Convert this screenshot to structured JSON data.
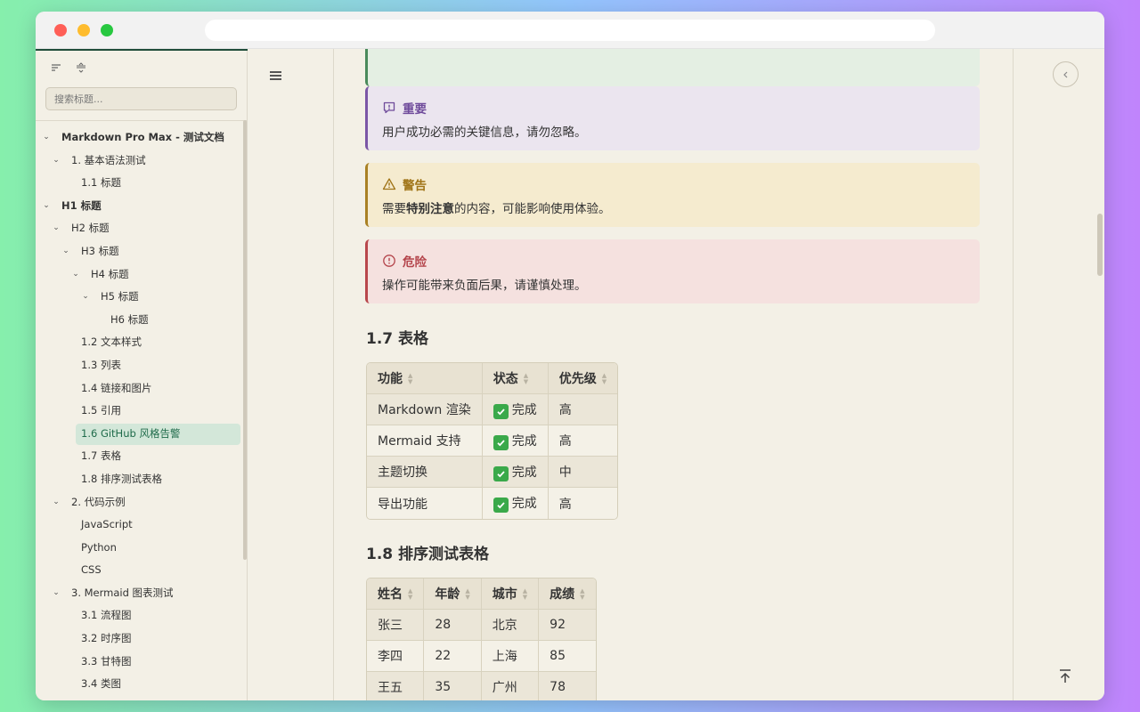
{
  "sidebar": {
    "search_placeholder": "搜索标题...",
    "toc": [
      {
        "label": "Markdown Pro Max - 测试文档",
        "level": 0,
        "chevron": true,
        "bold": true
      },
      {
        "label": "1. 基本语法测试",
        "level": 1,
        "chevron": true,
        "bold": false
      },
      {
        "label": "1.1 标题",
        "level": 2,
        "chevron": false,
        "bold": false
      },
      {
        "label": "H1 标题",
        "level": 0,
        "chevron": true,
        "bold": true
      },
      {
        "label": "H2 标题",
        "level": 1,
        "chevron": true,
        "bold": false
      },
      {
        "label": "H3 标题",
        "level": 2,
        "chevron": true,
        "bold": false
      },
      {
        "label": "H4 标题",
        "level": 3,
        "chevron": true,
        "bold": false
      },
      {
        "label": "H5 标题",
        "level": 4,
        "chevron": true,
        "bold": false
      },
      {
        "label": "H6 标题",
        "level": 5,
        "chevron": false,
        "bold": false
      },
      {
        "label": "1.2 文本样式",
        "level": 2,
        "chevron": false,
        "bold": false
      },
      {
        "label": "1.3 列表",
        "level": 2,
        "chevron": false,
        "bold": false
      },
      {
        "label": "1.4 链接和图片",
        "level": 2,
        "chevron": false,
        "bold": false
      },
      {
        "label": "1.5 引用",
        "level": 2,
        "chevron": false,
        "bold": false
      },
      {
        "label": "1.6 GitHub 风格告警",
        "level": 2,
        "chevron": false,
        "bold": false,
        "active": true
      },
      {
        "label": "1.7 表格",
        "level": 2,
        "chevron": false,
        "bold": false
      },
      {
        "label": "1.8 排序测试表格",
        "level": 2,
        "chevron": false,
        "bold": false
      },
      {
        "label": "2. 代码示例",
        "level": 1,
        "chevron": true,
        "bold": false
      },
      {
        "label": "JavaScript",
        "level": 2,
        "chevron": false,
        "bold": false
      },
      {
        "label": "Python",
        "level": 2,
        "chevron": false,
        "bold": false
      },
      {
        "label": "CSS",
        "level": 2,
        "chevron": false,
        "bold": false
      },
      {
        "label": "3. Mermaid 图表测试",
        "level": 1,
        "chevron": true,
        "bold": false
      },
      {
        "label": "3.1 流程图",
        "level": 2,
        "chevron": false,
        "bold": false
      },
      {
        "label": "3.2 时序图",
        "level": 2,
        "chevron": false,
        "bold": false
      },
      {
        "label": "3.3 甘特图",
        "level": 2,
        "chevron": false,
        "bold": false
      },
      {
        "label": "3.4 类图",
        "level": 2,
        "chevron": false,
        "bold": false
      }
    ]
  },
  "callouts": {
    "important": {
      "title": "重要",
      "body": "用户成功必需的关键信息，请勿忽略。"
    },
    "warning": {
      "title": "警告",
      "body_pre": "需要",
      "body_strong": "特别注意",
      "body_post": "的内容，可能影响使用体验。"
    },
    "danger": {
      "title": "危险",
      "body": "操作可能带来负面后果，请谨慎处理。"
    }
  },
  "section_17": {
    "heading": "1.7 表格",
    "headers": [
      "功能",
      "状态",
      "优先级"
    ],
    "rows": [
      [
        "Markdown 渲染",
        "完成",
        "高"
      ],
      [
        "Mermaid 支持",
        "完成",
        "高"
      ],
      [
        "主题切换",
        "完成",
        "中"
      ],
      [
        "导出功能",
        "完成",
        "高"
      ]
    ]
  },
  "section_18": {
    "heading": "1.8 排序测试表格",
    "headers": [
      "姓名",
      "年龄",
      "城市",
      "成绩"
    ],
    "rows": [
      [
        "张三",
        "28",
        "北京",
        "92"
      ],
      [
        "李四",
        "22",
        "上海",
        "85"
      ],
      [
        "王五",
        "35",
        "广州",
        "78"
      ],
      [
        "",
        "",
        "",
        ""
      ]
    ]
  },
  "colors": {
    "accent_green": "#1f6b4a",
    "important": "#6f4b9b",
    "warning": "#a07417",
    "danger": "#b4444b"
  },
  "icons": {
    "important": "message-alert-icon",
    "warning": "warning-triangle-icon",
    "danger": "alert-circle-icon",
    "status_done": "check-mark-icon"
  }
}
